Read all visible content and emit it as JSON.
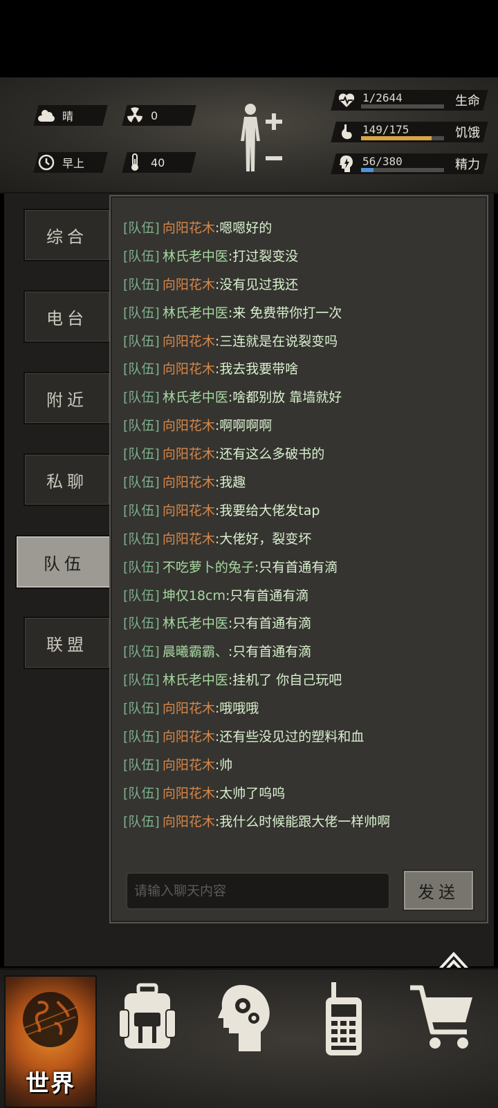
{
  "hud": {
    "weather": "晴",
    "radiation": "0",
    "time_of_day": "早上",
    "temperature": "40",
    "stats": [
      {
        "name": "health",
        "value": "1/2644",
        "label": "生命",
        "fraction": 0.0004,
        "color": "#c0463d"
      },
      {
        "name": "hunger",
        "value": "149/175",
        "label": "饥饿",
        "fraction": 0.85,
        "color": "#d9a443"
      },
      {
        "name": "energy",
        "value": "56/380",
        "label": "精力",
        "fraction": 0.147,
        "color": "#4e93d6"
      }
    ]
  },
  "tabs": [
    {
      "id": "general",
      "label": "综合",
      "active": false
    },
    {
      "id": "radio",
      "label": "电台",
      "active": false
    },
    {
      "id": "nearby",
      "label": "附近",
      "active": false
    },
    {
      "id": "private",
      "label": "私聊",
      "active": false
    },
    {
      "id": "team",
      "label": "队伍",
      "active": true
    },
    {
      "id": "alliance",
      "label": "联盟",
      "active": false
    }
  ],
  "colors": {
    "channel": "#7fb08e",
    "self_name": "#d6874a",
    "other_name": "#a7d8a2",
    "text": "#d9f0cf"
  },
  "chat": {
    "messages": [
      {
        "channel": "[队伍]",
        "sender": "向阳花木",
        "self": true,
        "text": "嗯嗯好的"
      },
      {
        "channel": "[队伍]",
        "sender": "林氏老中医",
        "self": false,
        "text": "打过裂变没"
      },
      {
        "channel": "[队伍]",
        "sender": "向阳花木",
        "self": true,
        "text": "没有见过我还"
      },
      {
        "channel": "[队伍]",
        "sender": "林氏老中医",
        "self": false,
        "text": "来 免费带你打一次"
      },
      {
        "channel": "[队伍]",
        "sender": "向阳花木",
        "self": true,
        "text": "三连就是在说裂变吗"
      },
      {
        "channel": "[队伍]",
        "sender": "向阳花木",
        "self": true,
        "text": "我去我要带啥"
      },
      {
        "channel": "[队伍]",
        "sender": "林氏老中医",
        "self": false,
        "text": "啥都别放 靠墙就好"
      },
      {
        "channel": "[队伍]",
        "sender": "向阳花木",
        "self": true,
        "text": "啊啊啊啊"
      },
      {
        "channel": "[队伍]",
        "sender": "向阳花木",
        "self": true,
        "text": "还有这么多破书的"
      },
      {
        "channel": "[队伍]",
        "sender": "向阳花木",
        "self": true,
        "text": "我趣"
      },
      {
        "channel": "[队伍]",
        "sender": "向阳花木",
        "self": true,
        "text": "我要给大佬发tap"
      },
      {
        "channel": "[队伍]",
        "sender": "向阳花木",
        "self": true,
        "text": "大佬好，裂变坏"
      },
      {
        "channel": "[队伍]",
        "sender": "不吃萝卜的兔子",
        "self": false,
        "text": "只有首通有滴"
      },
      {
        "channel": "[队伍]",
        "sender": "坤仅18cm",
        "self": false,
        "text": "只有首通有滴"
      },
      {
        "channel": "[队伍]",
        "sender": "林氏老中医",
        "self": false,
        "text": "只有首通有滴"
      },
      {
        "channel": "[队伍]",
        "sender": "晨曦霸霸、",
        "self": false,
        "text": "只有首通有滴"
      },
      {
        "channel": "[队伍]",
        "sender": "林氏老中医",
        "self": false,
        "text": "挂机了 你自己玩吧"
      },
      {
        "channel": "[队伍]",
        "sender": "向阳花木",
        "self": true,
        "text": "哦哦哦"
      },
      {
        "channel": "[队伍]",
        "sender": "向阳花木",
        "self": true,
        "text": "还有些没见过的塑料和血"
      },
      {
        "channel": "[队伍]",
        "sender": "向阳花木",
        "self": true,
        "text": "帅"
      },
      {
        "channel": "[队伍]",
        "sender": "向阳花木",
        "self": true,
        "text": "太帅了呜呜"
      },
      {
        "channel": "[队伍]",
        "sender": "向阳花木",
        "self": true,
        "text": "我什么时候能跟大佬一样帅啊"
      }
    ],
    "input_placeholder": "请输入聊天内容",
    "input_value": "",
    "send_label": "发送"
  },
  "nav": {
    "world_label": "世界",
    "icons": [
      "globe-icon",
      "backpack-icon",
      "skills-head-icon",
      "walkie-talkie-icon",
      "shopping-cart-icon"
    ]
  }
}
